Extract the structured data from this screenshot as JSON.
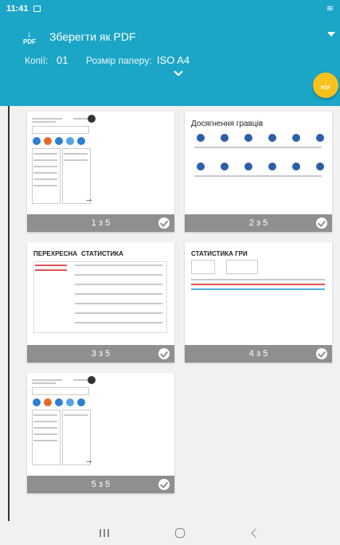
{
  "status_bar": {
    "time": "11:41"
  },
  "app_bar": {
    "title": "Зберегти як PDF",
    "pdf_icon_text": "PDF",
    "copies_label": "Копії:",
    "copies_value": "01",
    "paper_size_label": "Розмір паперу:",
    "paper_size_value": "ISO A4"
  },
  "fab": {
    "text": "PDF"
  },
  "pages": [
    {
      "label": "1 з 5",
      "selected": true
    },
    {
      "label": "2 з 5",
      "selected": true,
      "preview_title": "Досягнення гравців"
    },
    {
      "label": "3 з 5",
      "selected": true,
      "preview_title_left": "ПЕРЕХРЕСНА",
      "preview_title_right": "СТАТИСТИКА"
    },
    {
      "label": "4 з 5",
      "selected": true,
      "preview_title": "СТАТИСТИКА ГРИ"
    },
    {
      "label": "5 з 5",
      "selected": true
    }
  ],
  "colors": {
    "accent": "#1ba5c6",
    "fab": "#f8c11b",
    "card_footer": "#8f8f8f"
  }
}
